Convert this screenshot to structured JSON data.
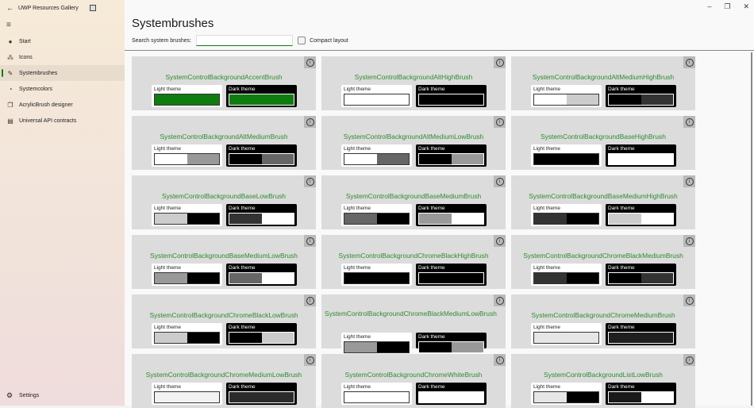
{
  "app": {
    "title": "UWP Resources Gallery"
  },
  "sidebar": {
    "items": [
      {
        "label": "Start",
        "icon": "info-filled-icon",
        "glyph": "●"
      },
      {
        "label": "Icons",
        "icon": "icons-icon",
        "glyph": "⁂"
      },
      {
        "label": "Systembrushes",
        "icon": "brush-icon",
        "glyph": "✎",
        "selected": true
      },
      {
        "label": "Systemcolors",
        "icon": "palette-icon",
        "glyph": "◔"
      },
      {
        "label": "AcrylicBrush designer",
        "icon": "copy-icon",
        "glyph": "❐"
      },
      {
        "label": "Universal API contracts",
        "icon": "document-icon",
        "glyph": "▤"
      }
    ],
    "settings": "Settings"
  },
  "page": {
    "title": "Systembrushes",
    "search_label": "Search system brushes:",
    "search_value": "",
    "compact_label": "Compact layout",
    "compact_checked": false
  },
  "labels": {
    "light": "Light theme",
    "dark": "Dark theme"
  },
  "brushes": [
    {
      "name": "SystemControlBackgroundAccentBrush",
      "light": [
        "#107c10",
        "#107c10"
      ],
      "dark": [
        "#107c10",
        "#107c10"
      ]
    },
    {
      "name": "SystemControlBackgroundAltHighBrush",
      "light": [
        "#ffffff",
        "#ffffff"
      ],
      "dark": [
        "#000000",
        "#000000"
      ]
    },
    {
      "name": "SystemControlBackgroundAltMediumHighBrush",
      "light": [
        "#ffffff",
        "#cccccc"
      ],
      "dark": [
        "#000000",
        "#333333"
      ]
    },
    {
      "name": "SystemControlBackgroundAltMediumBrush",
      "light": [
        "#ffffff",
        "#999999"
      ],
      "dark": [
        "#000000",
        "#666666"
      ]
    },
    {
      "name": "SystemControlBackgroundAltMediumLowBrush",
      "light": [
        "#ffffff",
        "#666666"
      ],
      "dark": [
        "#000000",
        "#999999"
      ]
    },
    {
      "name": "SystemControlBackgroundBaseHighBrush",
      "light": [
        "#000000",
        "#000000"
      ],
      "dark": [
        "#ffffff",
        "#ffffff"
      ]
    },
    {
      "name": "SystemControlBackgroundBaseLowBrush",
      "light": [
        "#cccccc",
        "#000000"
      ],
      "dark": [
        "#333333",
        "#ffffff"
      ]
    },
    {
      "name": "SystemControlBackgroundBaseMediumBrush",
      "light": [
        "#666666",
        "#000000"
      ],
      "dark": [
        "#999999",
        "#ffffff"
      ]
    },
    {
      "name": "SystemControlBackgroundBaseMediumHighBrush",
      "light": [
        "#333333",
        "#000000"
      ],
      "dark": [
        "#cccccc",
        "#ffffff"
      ]
    },
    {
      "name": "SystemControlBackgroundBaseMediumLowBrush",
      "light": [
        "#999999",
        "#000000"
      ],
      "dark": [
        "#666666",
        "#ffffff"
      ]
    },
    {
      "name": "SystemControlBackgroundChromeBlackHighBrush",
      "light": [
        "#000000",
        "#000000"
      ],
      "dark": [
        "#000000",
        "#000000"
      ]
    },
    {
      "name": "SystemControlBackgroundChromeBlackMediumBrush",
      "light": [
        "#333333",
        "#000000"
      ],
      "dark": [
        "#000000",
        "#333333"
      ]
    },
    {
      "name": "SystemControlBackgroundChromeBlackLowBrush",
      "light": [
        "#cccccc",
        "#000000"
      ],
      "dark": [
        "#000000",
        "#cccccc"
      ]
    },
    {
      "name": "SystemControlBackgroundChromeBlackMediumLowBrush",
      "light": [
        "#999999",
        "#000000"
      ],
      "dark": [
        "#000000",
        "#999999"
      ],
      "wrap": true
    },
    {
      "name": "SystemControlBackgroundChromeMediumBrush",
      "light": [
        "#e6e6e6",
        "#e6e6e6"
      ],
      "dark": [
        "#1f1f1f",
        "#1f1f1f"
      ]
    },
    {
      "name": "SystemControlBackgroundChromeMediumLowBrush",
      "light": [
        "#f2f2f2",
        "#f2f2f2"
      ],
      "dark": [
        "#2b2b2b",
        "#2b2b2b"
      ]
    },
    {
      "name": "SystemControlBackgroundChromeWhiteBrush",
      "light": [
        "#ffffff",
        "#ffffff"
      ],
      "dark": [
        "#ffffff",
        "#ffffff"
      ]
    },
    {
      "name": "SystemControlBackgroundListLowBrush",
      "light": [
        "#e6e6e6",
        "#000000"
      ],
      "dark": [
        "#1a1a1a",
        "#ffffff"
      ]
    }
  ]
}
